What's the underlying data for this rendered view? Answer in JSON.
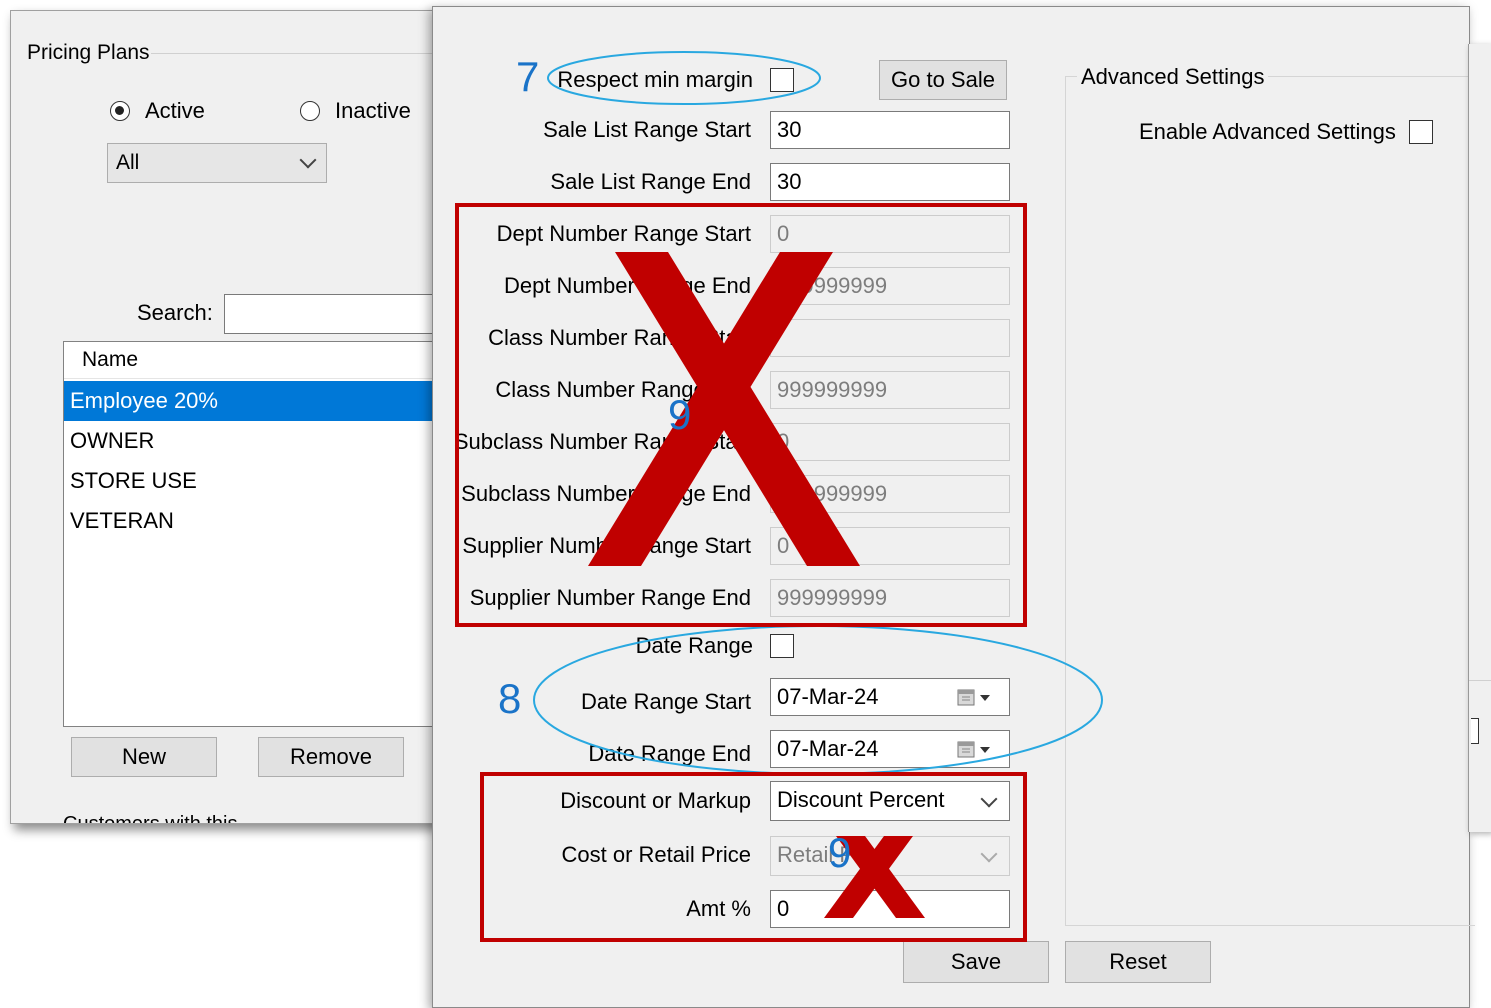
{
  "pricing_plans": {
    "group_title": "Pricing Plans",
    "active_label": "Active",
    "inactive_label": "Inactive",
    "active_selected": true,
    "filter_value": "All",
    "search_label": "Search:",
    "search_value": "",
    "list_header": "Name",
    "plans": [
      "Employee 20%",
      "OWNER",
      "STORE USE",
      "VETERAN"
    ],
    "selected_plan_index": 0,
    "new_button": "New",
    "remove_button": "Remove",
    "footer_text_partial": "Customers with this ..."
  },
  "dialog": {
    "respect_min_margin_label": "Respect min margin",
    "respect_min_margin_checked": false,
    "go_to_sale_button": "Go to Sale",
    "fields": [
      {
        "label": "Sale List Range Start",
        "value": "30",
        "disabled": false
      },
      {
        "label": "Sale List Range End",
        "value": "30",
        "disabled": false
      },
      {
        "label": "Dept Number Range Start",
        "value": "0",
        "disabled": true
      },
      {
        "label": "Dept Number Range End",
        "value": "999999999",
        "disabled": true
      },
      {
        "label": "Class Number Range Start",
        "value": "",
        "disabled": true
      },
      {
        "label": "Class Number Range End",
        "value": "999999999",
        "disabled": true
      },
      {
        "label": "Subclass Number Range Start",
        "value": "0",
        "disabled": true
      },
      {
        "label": "Subclass Number Range End",
        "value": "999999999",
        "disabled": true
      },
      {
        "label": "Supplier Number Range Start",
        "value": "0",
        "disabled": true
      },
      {
        "label": "Supplier Number Range End",
        "value": "999999999",
        "disabled": true
      }
    ],
    "date_range_label": "Date Range",
    "date_range_checked": false,
    "date_range_start_label": "Date Range Start",
    "date_range_start_value": "07-Mar-24",
    "date_range_end_label": "Date Range End",
    "date_range_end_value": "07-Mar-24",
    "discount_or_markup_label": "Discount or Markup",
    "discount_or_markup_value": "Discount Percent",
    "cost_or_retail_label": "Cost or Retail Price",
    "cost_or_retail_value": "Retail Price",
    "amt_label": "Amt %",
    "amt_value": "0",
    "advanced_settings_title": "Advanced Settings",
    "enable_advanced_label": "Enable Advanced Settings",
    "enable_advanced_checked": false,
    "save_button": "Save",
    "reset_button": "Reset"
  },
  "annotations": {
    "marker_7": "7",
    "marker_8": "8",
    "marker_9_top": "9",
    "marker_9_bottom": "9",
    "ellipse_color": "#29a8e0",
    "cross_color": "#c00000",
    "number_color": "#1a73c8"
  }
}
